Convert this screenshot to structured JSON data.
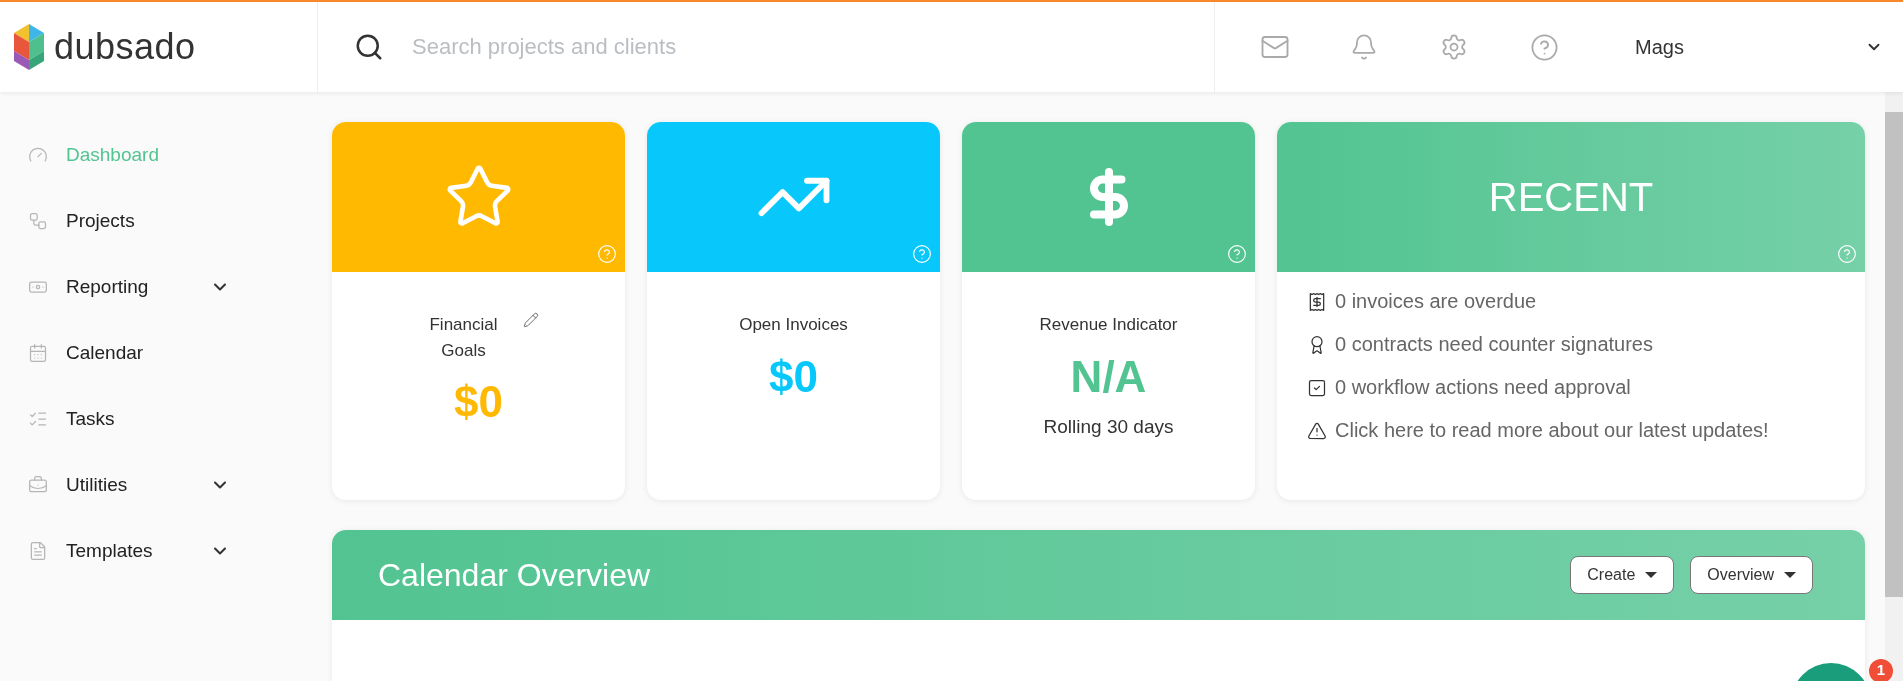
{
  "header": {
    "logo": "dubsado",
    "search": {
      "placeholder": "Search projects and clients"
    },
    "user": "Mags"
  },
  "sidebar": {
    "items": [
      {
        "label": "Dashboard",
        "selected": true,
        "has_submenu": false
      },
      {
        "label": "Projects",
        "selected": false,
        "has_submenu": false
      },
      {
        "label": "Reporting",
        "selected": false,
        "has_submenu": true
      },
      {
        "label": "Calendar",
        "selected": false,
        "has_submenu": false
      },
      {
        "label": "Tasks",
        "selected": false,
        "has_submenu": false
      },
      {
        "label": "Utilities",
        "selected": false,
        "has_submenu": true
      },
      {
        "label": "Templates",
        "selected": false,
        "has_submenu": true
      }
    ]
  },
  "cards": [
    {
      "kind": "goal",
      "title": "Financial Goals",
      "value": "$0",
      "color": "#ffb900"
    },
    {
      "kind": "invoices",
      "title": "Open Invoices",
      "value": "$0",
      "color": "#08c8fb"
    },
    {
      "kind": "revenue",
      "title": "Revenue Indicator",
      "value": "N/A",
      "subtitle": "Rolling 30 days",
      "color": "#52c491"
    }
  ],
  "recent": {
    "title": "RECENT",
    "items": [
      {
        "kind": "invoice",
        "text": "0 invoices are overdue"
      },
      {
        "kind": "contract",
        "text": "0 contracts need counter signatures"
      },
      {
        "kind": "workflow",
        "text": "0 workflow actions need approval"
      },
      {
        "kind": "alert",
        "text": "Click here to read more about our latest updates!"
      }
    ]
  },
  "calendar": {
    "title": "Calendar Overview",
    "buttons": [
      "Create",
      "Overview"
    ]
  },
  "chat": {
    "badge": "1"
  }
}
